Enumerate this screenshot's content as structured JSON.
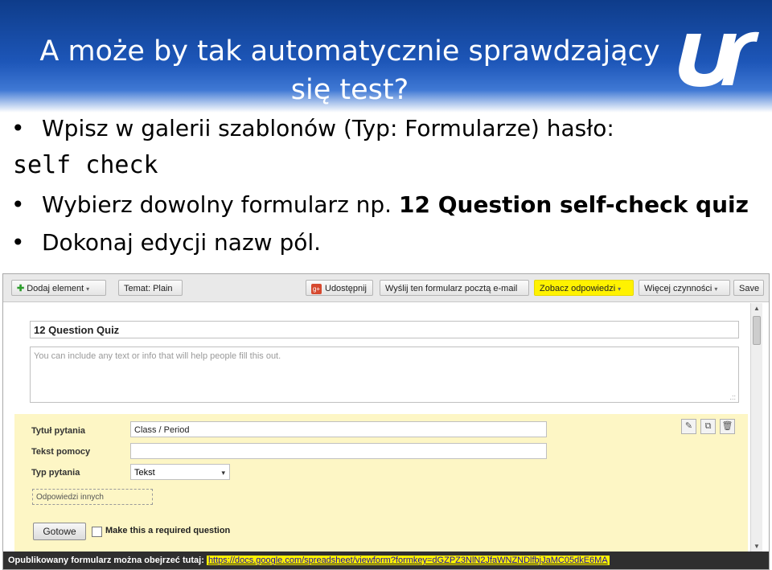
{
  "slide": {
    "title_line1": "A może by tak automatycznie sprawdzający",
    "title_line2": "się test?",
    "bullets": [
      "Wpisz w galerii szablonów (Typ: Formularze) hasło:",
      "Wybierz dowolny formularz np.",
      "Dokonaj edycji nazw pól."
    ],
    "code_text": "self check",
    "bullet2_bold": "12 Question self-check quiz",
    "bullet_glyph": "•"
  },
  "toolbar": {
    "add_element": "Dodaj element",
    "theme": "Temat: Plain",
    "share": "Udostępnij",
    "send_email": "Wyślij ten formularz pocztą e-mail",
    "view_responses": "Zobacz odpowiedzi",
    "more_actions": "Więcej czynności",
    "save": "Save",
    "gplus_glyph": "g+",
    "caret_glyph": "▾",
    "plus_glyph": "✚"
  },
  "form": {
    "title": "12 Question Quiz",
    "description_placeholder": "You can include any text or info that will help people fill this out.",
    "resize_glyph": ".::"
  },
  "question": {
    "title_label": "Tytuł pytania",
    "title_value": "Class / Period",
    "help_label": "Tekst pomocy",
    "help_value": "",
    "type_label": "Typ pytania",
    "type_value": "Tekst",
    "other_answers": "Odpowiedzi innych",
    "done": "Gotowe",
    "required": "Make this a required question",
    "icons": {
      "edit": "✎",
      "duplicate": "⧉",
      "delete": "🗑"
    }
  },
  "footer": {
    "text": "Opublikowany formularz można obejrzeć tutaj:",
    "url": "https://docs.google.com/spreadsheet/viewform?formkey=dGZPZ3NlN2JfaWNZNDlfbjJaMC05dkE6MA"
  },
  "scroll": {
    "up": "▲",
    "down": "▼"
  },
  "colors": {
    "header": "#1d56b8",
    "highlight": "#fff200",
    "question_bg": "#fdf6c5"
  }
}
